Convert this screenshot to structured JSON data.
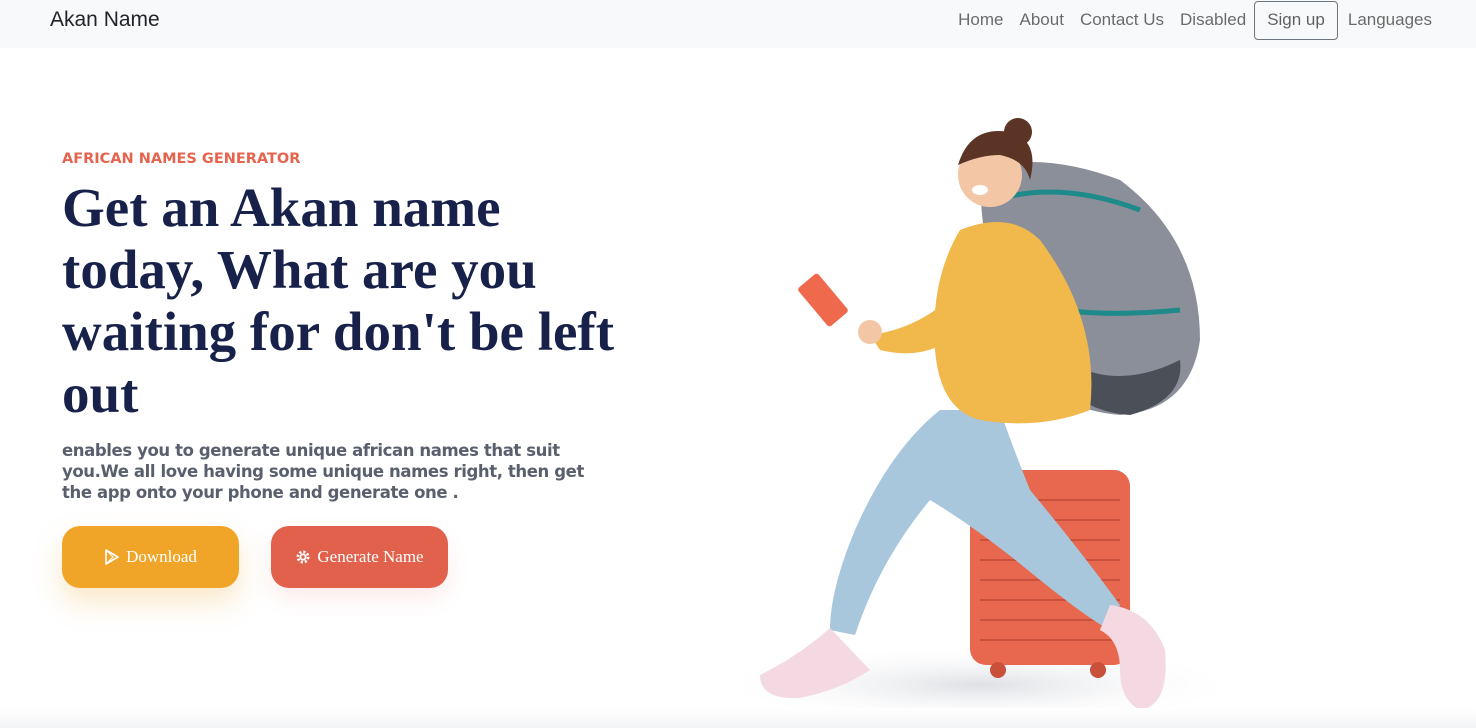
{
  "navbar": {
    "brand": "Akan Name",
    "links": [
      "Home",
      "About",
      "Contact Us",
      "Disabled"
    ],
    "signup": "Sign up",
    "languages": "Languages"
  },
  "hero": {
    "eyebrow": "AFRICAN NAMES GENERATOR",
    "headline": "Get an Akan name today, What are you waiting for don't be left out",
    "lead": "enables you to generate unique african names that suit you.We all love having some unique names right, then get the app onto your phone and generate one .",
    "download_label": "Download",
    "generate_label": "Generate Name"
  },
  "icons": {
    "download": "play-store-icon",
    "generate": "gear-icon"
  },
  "colors": {
    "accent_orange": "#f1a528",
    "accent_red": "#e1614c",
    "headline": "#17214a",
    "eyebrow": "#e4644e"
  }
}
